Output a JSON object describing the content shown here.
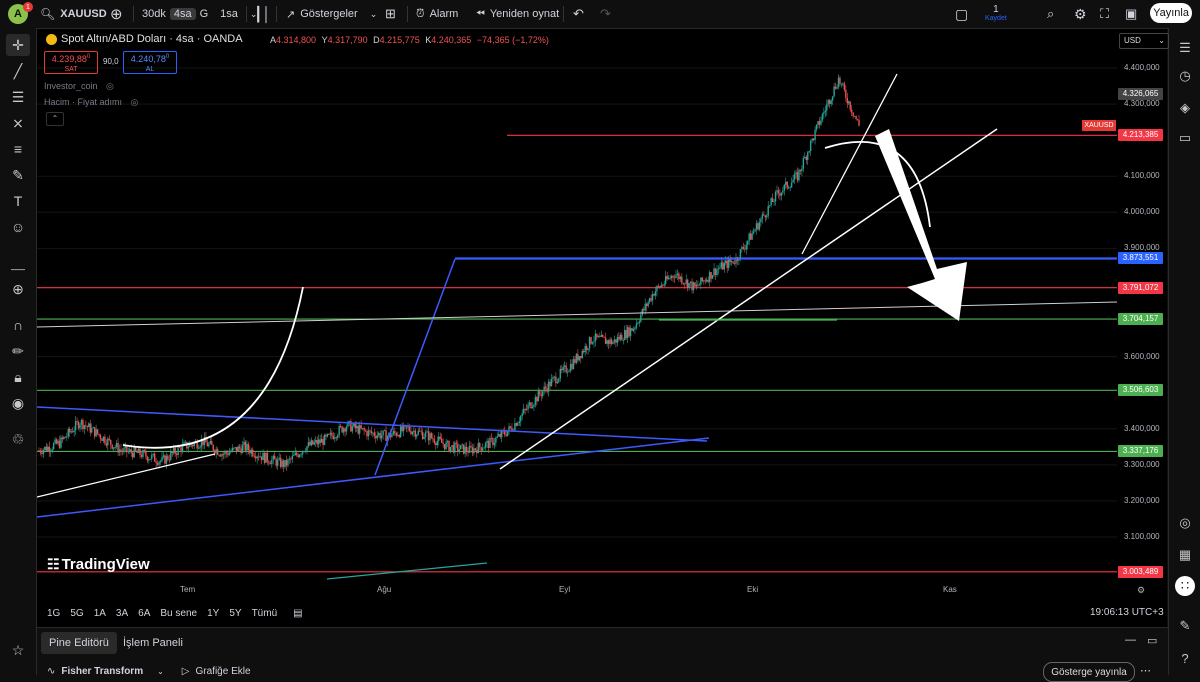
{
  "topbar": {
    "avatar_letter": "A",
    "notification_count": "1",
    "symbol": "XAUUSD",
    "intervals": [
      "30dk",
      "4sa",
      "G",
      "1sa"
    ],
    "indicators_label": "Göstergeler",
    "alert_label": "Alarm",
    "replay_label": "Yeniden oynat",
    "save_count": "1",
    "save_label": "Kaydet",
    "publish_label": "Yayınla"
  },
  "legend": {
    "title": "Spot Altın/ABD Doları · 4sa · OANDA",
    "o_label": "A",
    "o_value": "4.314,800",
    "h_label": "Y",
    "h_value": "4.317,790",
    "l_label": "D",
    "l_value": "4.215,775",
    "c_label": "K",
    "c_value": "4.240,365",
    "change": "−74,365 (−1,72%)",
    "sell_price": "4.239,88",
    "sell_sup": "0",
    "sell_label": "SAT",
    "spread": "90,0",
    "buy_price": "4.240,78",
    "buy_sup": "0",
    "buy_label": "AL",
    "indicator1": "Investor_coin",
    "indicator2": "Hacim · Fiyat adımı"
  },
  "currency": "USD",
  "chart_data": {
    "type": "candlestick",
    "symbol": "XAUUSD",
    "title": "Spot Altın/ABD Doları · 4sa · OANDA",
    "ylim": [
      3000,
      4400
    ],
    "y_ticks": [
      "4.400,000",
      "4.300,000",
      "4.100,000",
      "4.000,000",
      "3.900,000",
      "3.600,000",
      "3.400,000",
      "3.300,000",
      "3.200,000",
      "3.100,000"
    ],
    "x_ticks": [
      "Tem",
      "Ağu",
      "Eyl",
      "Eki",
      "Kas"
    ],
    "close_series": [
      3340,
      3360,
      3420,
      3380,
      3340,
      3330,
      3310,
      3350,
      3365,
      3330,
      3350,
      3320,
      3300,
      3350,
      3370,
      3410,
      3390,
      3380,
      3400,
      3380,
      3350,
      3340,
      3360,
      3400,
      3470,
      3530,
      3580,
      3650,
      3640,
      3680,
      3780,
      3830,
      3790,
      3840,
      3870,
      3960,
      4050,
      4100,
      4240,
      4370,
      4240
    ],
    "horizontal_levels": [
      {
        "price": 4213.385,
        "label": "4.213,385",
        "color": "#f23645",
        "kind": "last"
      },
      {
        "price": 3873.551,
        "label": "3.873,551",
        "color": "#2962ff"
      },
      {
        "price": 3791.072,
        "label": "3.791,072",
        "color": "#f23645"
      },
      {
        "price": 3704.157,
        "label": "3.704,157",
        "color": "#4caf50"
      },
      {
        "price": 3506.603,
        "label": "3.506,603",
        "color": "#4caf50"
      },
      {
        "price": 3337.176,
        "label": "3.337,176",
        "color": "#4caf50"
      },
      {
        "price": 3003.489,
        "label": "3.003,489",
        "color": "#f23645"
      }
    ],
    "current_price_label": "4.326,065"
  },
  "range_buttons": [
    "1G",
    "5G",
    "1A",
    "3A",
    "6A",
    "Bu sene",
    "1Y",
    "5Y",
    "Tümü"
  ],
  "clock": "19:06:13 UTC+3",
  "watermark": "TradingView",
  "bottom": {
    "tab1": "Pine Editörü",
    "tab2": "İşlem Paneli",
    "script_name": "Fisher Transform",
    "add_to_chart": "Grafiğe Ekle",
    "publish_indicator": "Gösterge yayınla"
  }
}
